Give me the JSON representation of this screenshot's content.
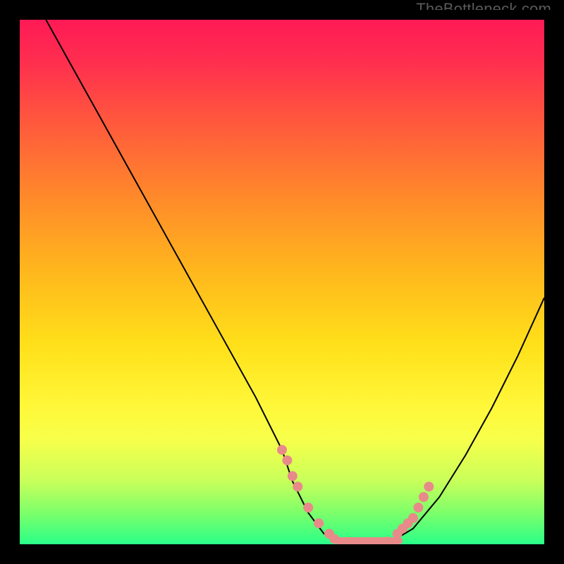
{
  "watermark": "TheBottleneck.com",
  "chart_data": {
    "type": "line",
    "title": "",
    "xlabel": "",
    "ylabel": "",
    "xlim": [
      0,
      100
    ],
    "ylim": [
      0,
      100
    ],
    "grid": false,
    "series": [
      {
        "name": "bottleneck-curve",
        "x": [
          5,
          10,
          15,
          20,
          25,
          30,
          35,
          40,
          45,
          50,
          52,
          55,
          58,
          62,
          65,
          70,
          75,
          80,
          85,
          90,
          95,
          100
        ],
        "y": [
          100,
          91,
          82,
          73,
          64,
          55,
          46,
          37,
          28,
          18,
          12,
          6,
          2,
          0,
          0,
          0,
          3,
          9,
          17,
          26,
          36,
          47
        ]
      }
    ],
    "highlight_points": {
      "name": "highlighted-samples",
      "x": [
        50,
        51,
        52,
        53,
        55,
        57,
        59,
        60,
        62,
        64,
        66,
        68,
        70,
        72,
        73,
        74,
        75,
        76,
        77,
        78
      ],
      "y": [
        18,
        16,
        13,
        11,
        7,
        4,
        2,
        1,
        0,
        0,
        0,
        0,
        0.5,
        2,
        3,
        4,
        5,
        7,
        9,
        11
      ]
    },
    "bottom_band": {
      "x": [
        60,
        62,
        64,
        66,
        68,
        70
      ],
      "length": 3
    }
  },
  "colors": {
    "background_black": "#000000",
    "curve": "#000000",
    "highlight": "#e88a8a",
    "gradient_top": "#ff1a55",
    "gradient_bottom": "#2aff88"
  }
}
